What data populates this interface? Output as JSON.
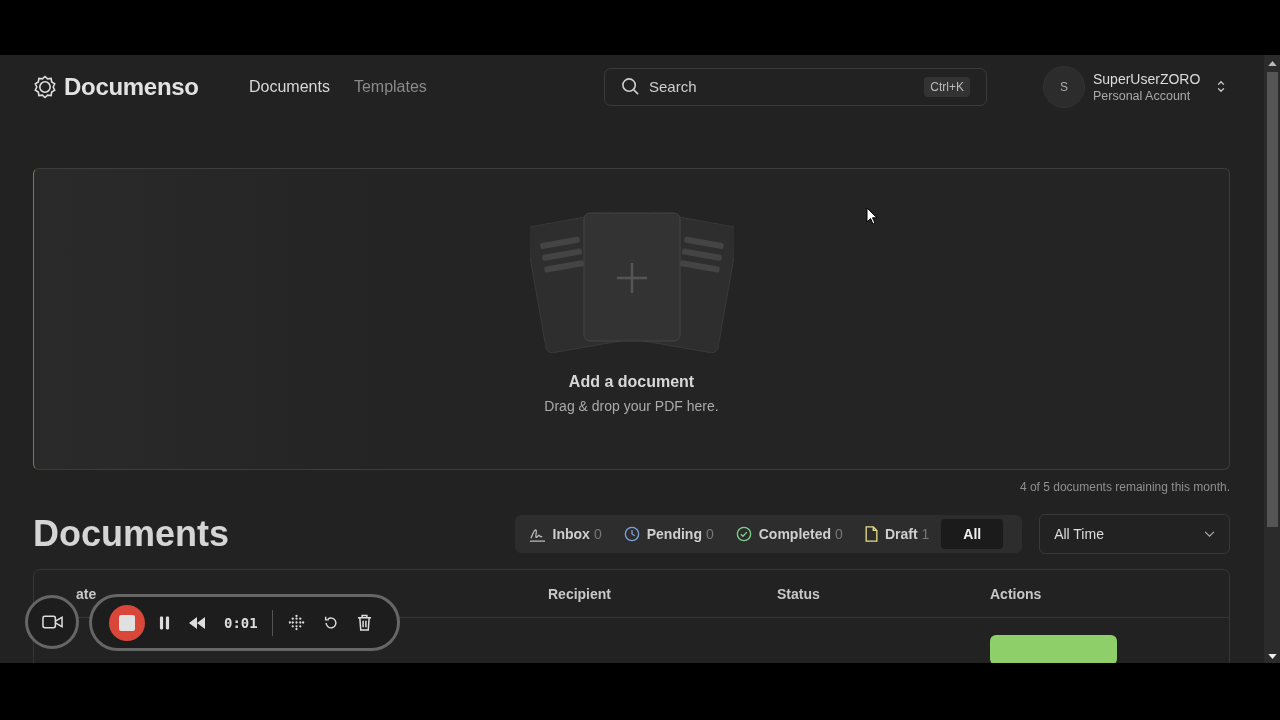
{
  "header": {
    "logo": "Documenso",
    "nav": [
      {
        "label": "Documents",
        "selected": true
      },
      {
        "label": "Templates",
        "selected": false
      }
    ],
    "search": {
      "placeholder": "Search",
      "shortcut": "Ctrl+K"
    },
    "account": {
      "avatar": "S",
      "name": "SuperUserZORO",
      "subtitle": "Personal Account"
    }
  },
  "upload": {
    "title": "Add a document",
    "hint": "Drag & drop your PDF here."
  },
  "quota": "4 of 5 documents remaining this month.",
  "documents": {
    "title": "Documents",
    "tabs": [
      {
        "kind": "inbox",
        "label": "Inbox",
        "count": "0",
        "selected": false
      },
      {
        "kind": "pending",
        "label": "Pending",
        "count": "0",
        "selected": false
      },
      {
        "kind": "completed",
        "label": "Completed",
        "count": "0",
        "selected": false
      },
      {
        "kind": "draft",
        "label": "Draft",
        "count": "1",
        "selected": false
      },
      {
        "kind": "all",
        "label": "All",
        "selected": true
      }
    ],
    "period": "All Time"
  },
  "table": {
    "columns": [
      "ate",
      "Recipient",
      "Status",
      "Actions"
    ]
  },
  "recorder": {
    "time": "0:01"
  }
}
